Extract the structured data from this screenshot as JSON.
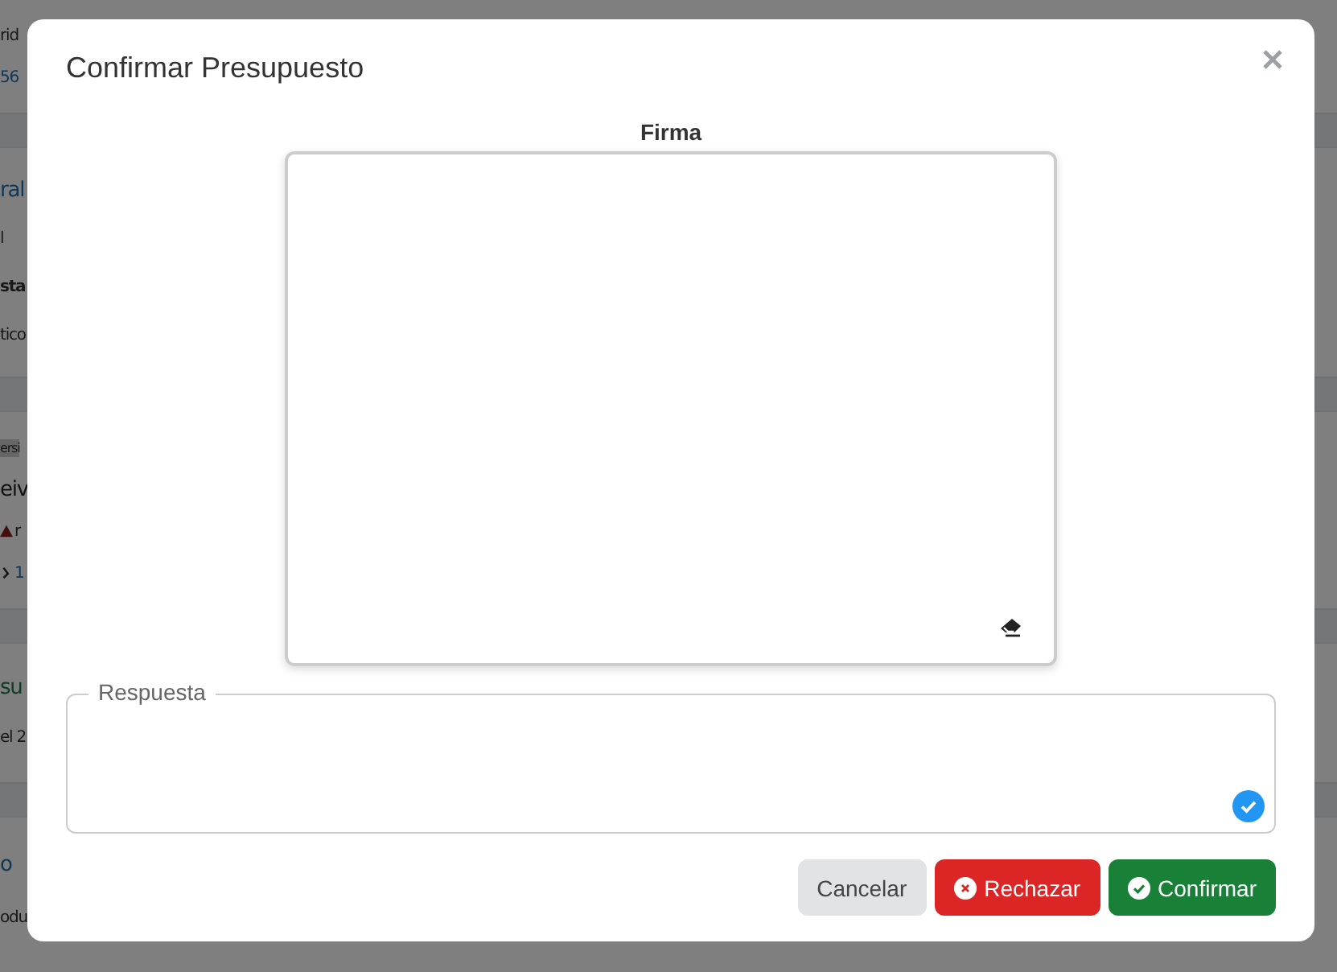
{
  "background": {
    "cards": [
      {
        "lines": [
          {
            "kind": "plain",
            "text": "rid"
          },
          {
            "kind": "link",
            "text": "56"
          }
        ]
      },
      {
        "lines": [
          {
            "kind": "title",
            "text": "ral"
          },
          {
            "kind": "plain",
            "text": "l"
          },
          {
            "kind": "bold",
            "text": "sta"
          },
          {
            "kind": "plain",
            "text": "tico"
          }
        ]
      },
      {
        "lines": [
          {
            "kind": "badge",
            "text": "ersi"
          },
          {
            "kind": "title-dark",
            "text": "eiv"
          },
          {
            "kind": "warning",
            "text": "r"
          },
          {
            "kind": "link-icon",
            "text": "1"
          }
        ]
      },
      {
        "lines": [
          {
            "kind": "title-green",
            "text": "su"
          },
          {
            "kind": "plain",
            "text": "el 2"
          }
        ]
      },
      {
        "lines": [
          {
            "kind": "title",
            "text": "o"
          },
          {
            "kind": "plain",
            "text": "odu"
          }
        ]
      }
    ]
  },
  "modal": {
    "title": "Confirmar Presupuesto",
    "signature": {
      "label": "Firma"
    },
    "response": {
      "label": "Respuesta",
      "valid": true
    },
    "buttons": [
      {
        "kind": "cancel",
        "label": "Cancelar"
      },
      {
        "kind": "reject",
        "label": "Rechazar"
      },
      {
        "kind": "confirm",
        "label": "Confirmar"
      }
    ]
  }
}
